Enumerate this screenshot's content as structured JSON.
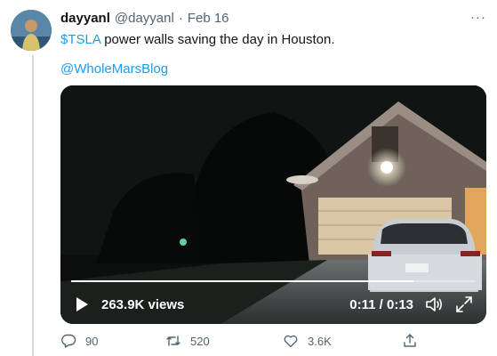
{
  "tweet": {
    "display_name": "dayyanl",
    "handle": "@dayyanl",
    "separator": "·",
    "date": "Feb 16",
    "more_label": "···",
    "ticker": "$TSLA",
    "text": " power walls saving the day in Houston.",
    "mention": "@WholeMarsBlog"
  },
  "video": {
    "views": "263.9K views",
    "time": "0:11 / 0:13",
    "progress": 0.846
  },
  "actions": {
    "replies": "90",
    "retweets": "520",
    "likes": "3.6K"
  },
  "colors": {
    "accent": "#1d9bf0",
    "muted": "#536471",
    "text": "#0f1419"
  },
  "icons": [
    "avatar",
    "more-icon",
    "play-icon",
    "volume-icon",
    "fullscreen-icon",
    "reply-icon",
    "retweet-icon",
    "like-icon",
    "share-icon"
  ]
}
